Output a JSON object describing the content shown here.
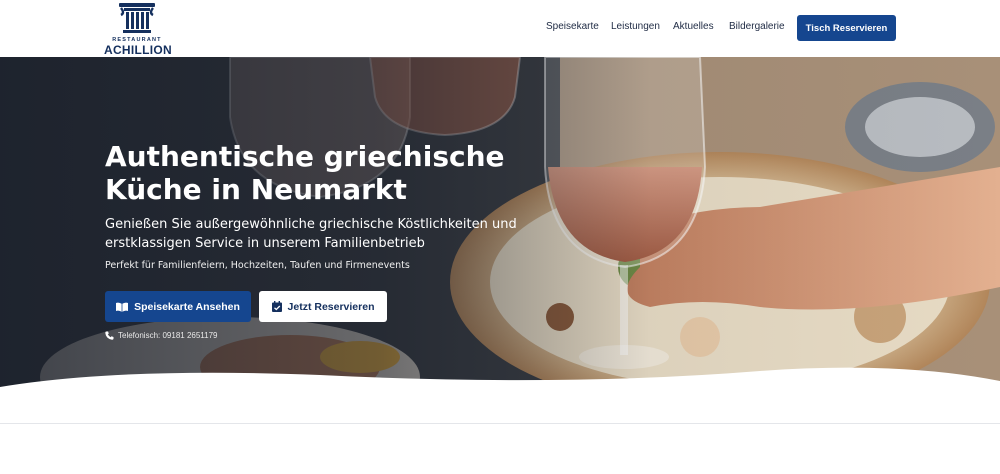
{
  "brand": {
    "small": "RESTAURANT",
    "name": "ACHILLION",
    "logo_icon": "greek-column-icon",
    "color": "#15305e"
  },
  "nav": {
    "items": [
      {
        "label": "Speisekarte"
      },
      {
        "label": "Leistungen"
      },
      {
        "label": "Aktuelles"
      },
      {
        "label": "Bildergalerie"
      }
    ],
    "cta_label": "Tisch Reservieren"
  },
  "hero": {
    "title": "Authentische griechische Küche in Neumarkt",
    "subtitle": "Genießen Sie außergewöhnliche griechische Köstlichkeiten und erstklassigen Service in unserem Familienbetrieb",
    "tagline": "Perfekt für Familienfeiern, Hochzeiten, Taufen und Firmenevents",
    "btn_menu_label": "Speisekarte Ansehen",
    "btn_menu_icon": "book-open-icon",
    "btn_reserve_label": "Jetzt Reservieren",
    "btn_reserve_icon": "calendar-check-icon",
    "phone_text": "Telefonisch: 09181 2651179",
    "phone_icon": "phone-icon"
  },
  "colors": {
    "primary": "#15468f",
    "dark": "#15305e",
    "white": "#ffffff"
  }
}
